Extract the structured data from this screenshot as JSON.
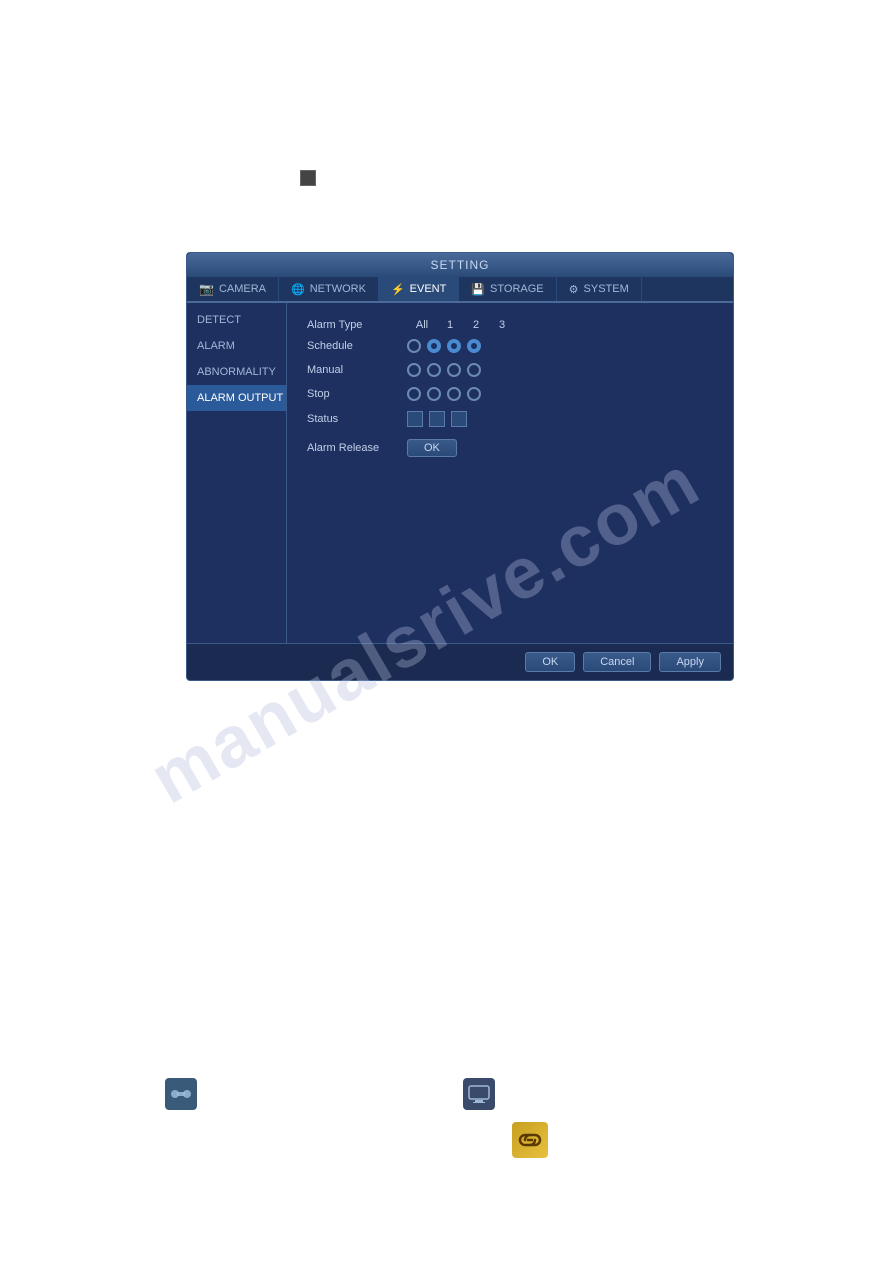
{
  "dialog": {
    "title": "SETTING",
    "tabs": [
      {
        "id": "camera",
        "label": "CAMERA",
        "icon": "camera-icon",
        "active": false
      },
      {
        "id": "network",
        "label": "NETWORK",
        "icon": "network-icon",
        "active": false
      },
      {
        "id": "event",
        "label": "EVENT",
        "icon": "event-icon",
        "active": true
      },
      {
        "id": "storage",
        "label": "STORAGE",
        "icon": "storage-icon",
        "active": false
      },
      {
        "id": "system",
        "label": "SYSTEM",
        "icon": "system-icon",
        "active": false
      }
    ],
    "sidebar": {
      "items": [
        {
          "id": "detect",
          "label": "DETECT",
          "active": false
        },
        {
          "id": "alarm",
          "label": "ALARM",
          "active": false
        },
        {
          "id": "abnormality",
          "label": "ABNORMALITY",
          "active": false
        },
        {
          "id": "alarm-output",
          "label": "ALARM OUTPUT",
          "active": true
        }
      ]
    },
    "main": {
      "col_headers": {
        "label": "Alarm Type",
        "all": "All",
        "col1": "1",
        "col2": "2",
        "col3": "3"
      },
      "rows": [
        {
          "label": "Schedule",
          "radio_all": false,
          "filled": true,
          "cols": [
            true,
            true,
            true
          ]
        },
        {
          "label": "Manual",
          "radio_all": false,
          "filled": false,
          "cols": [
            false,
            false,
            false
          ]
        },
        {
          "label": "Stop",
          "radio_all": false,
          "filled": false,
          "cols": [
            false,
            false,
            false
          ]
        },
        {
          "label": "Status",
          "checkbox": true,
          "cols": [
            false,
            false,
            false
          ]
        }
      ],
      "alarm_release": {
        "label": "Alarm Release",
        "button_label": "OK"
      }
    },
    "buttons": {
      "ok": "OK",
      "cancel": "Cancel",
      "apply": "Apply"
    }
  },
  "watermark": "manualsrive.com",
  "icons": {
    "link": "🔗",
    "monitor": "🖥",
    "chain": "🔗"
  }
}
